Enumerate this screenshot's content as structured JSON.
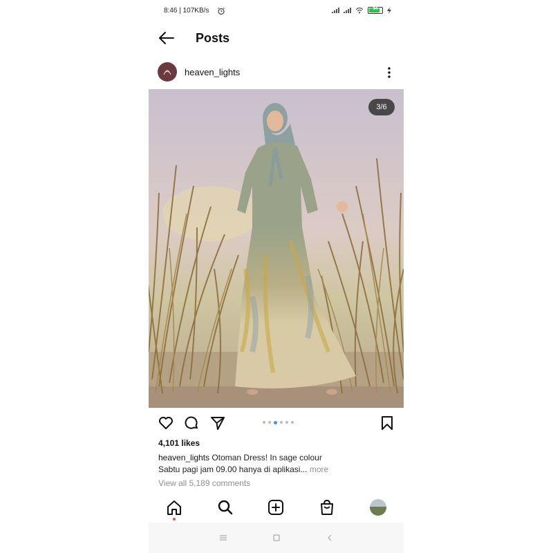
{
  "status_bar": {
    "time_text": "8:46 | 107KB/s",
    "battery_level": "94",
    "icons": [
      "alarm-icon",
      "signal-icon",
      "signal-icon",
      "wifi-icon",
      "battery-icon",
      "charging-icon"
    ]
  },
  "header": {
    "title": "Posts",
    "back_icon": "arrow-left-icon"
  },
  "post": {
    "username": "heaven_lights",
    "image_counter": "3/6",
    "carousel": {
      "current": 3,
      "total": 6
    },
    "likes": "4,101 likes",
    "caption_user": "heaven_lights",
    "caption_line1": "Otoman Dress! In sage colour",
    "caption_line2": "Sabtu pagi jam 09.00 hanya di aplikasi...",
    "caption_more": "more",
    "view_comments": "View all 5,189 comments"
  },
  "actions": {
    "icons": [
      "heart-icon",
      "comment-icon",
      "share-icon",
      "bookmark-icon"
    ]
  },
  "bottom_nav": {
    "icons": [
      "home-icon",
      "search-icon",
      "new-post-icon",
      "shop-icon",
      "profile-avatar"
    ]
  },
  "system_nav": {
    "icons": [
      "menu-icon",
      "home-square-icon",
      "back-triangle-icon"
    ]
  },
  "colors": {
    "accent": "#3897f0",
    "notification": "#ed4956",
    "muted": "#8e8e8e",
    "text": "#111111"
  }
}
